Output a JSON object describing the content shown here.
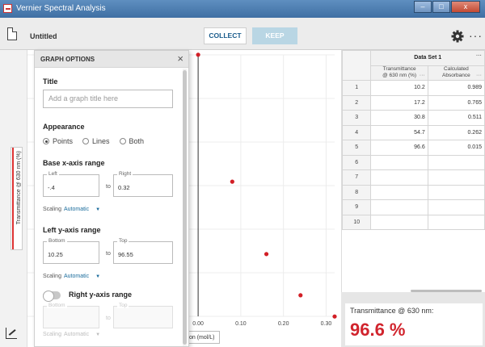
{
  "window": {
    "title": "Vernier Spectral Analysis",
    "minimize": "–",
    "maximize": "□",
    "close": "x"
  },
  "toolbar": {
    "doc_title": "Untitled",
    "collect_label": "COLLECT",
    "keep_label": "KEEP",
    "more": "···"
  },
  "graph_options": {
    "header": "GRAPH OPTIONS",
    "close": "×",
    "title_section": "Title",
    "title_placeholder": "Add a graph title here",
    "appearance_section": "Appearance",
    "appearance_options": [
      "Points",
      "Lines",
      "Both"
    ],
    "appearance_selected": "Points",
    "base_x": {
      "section": "Base x-axis range",
      "left_label": "Left",
      "left_value": "-.4",
      "right_label": "Right",
      "right_value": "0.32",
      "to": "to",
      "scaling_label": "Scaling",
      "scaling_value": "Automatic"
    },
    "left_y": {
      "section": "Left y-axis range",
      "bottom_label": "Bottom",
      "bottom_value": "10.25",
      "top_label": "Top",
      "top_value": "96.55",
      "to": "to",
      "scaling_label": "Scaling",
      "scaling_value": "Automatic"
    },
    "right_y": {
      "section": "Right y-axis range",
      "enabled": false,
      "bottom_label": "Bottom",
      "top_label": "Top",
      "to": "to",
      "scaling_label": "Scaling",
      "scaling_value": "Automatic"
    }
  },
  "graph": {
    "y_axis_label": "Transmittance @ 630 nm (%)",
    "x_axis_chip": "on (mol/L)"
  },
  "chart_data": {
    "type": "scatter",
    "x_ticks": [
      "0.00",
      "0.10",
      "0.20",
      "0.30"
    ],
    "xlim": [
      -0.4,
      0.32
    ],
    "ylim": [
      10.25,
      96.55
    ],
    "series": [
      {
        "values": [
          {
            "x": 0.08,
            "y": 54.7
          },
          {
            "x": 0.16,
            "y": 30.8
          },
          {
            "x": 0.24,
            "y": 17.2
          },
          {
            "x": 0.32,
            "y": 10.2
          },
          {
            "x": 0.0,
            "y": 96.6
          }
        ]
      }
    ],
    "point_color": "#d21f26"
  },
  "table": {
    "dataset": "Data Set 1",
    "col1_header_line1": "Transmittance",
    "col1_header_line2": "@ 630 nm (%)",
    "col2_header_line1": "Calculated",
    "col2_header_line2": "Absorbance",
    "more": "···",
    "row_numbers": [
      "1",
      "2",
      "3",
      "4",
      "5",
      "6",
      "7",
      "8",
      "9",
      "10"
    ],
    "col1": [
      "10.2",
      "17.2",
      "30.8",
      "54.7",
      "96.6",
      "",
      "",
      "",
      "",
      ""
    ],
    "col2": [
      "0.989",
      "0.765",
      "0.511",
      "0.262",
      "0.015",
      "",
      "",
      "",
      "",
      ""
    ]
  },
  "meter": {
    "label": "Transmittance @ 630 nm:",
    "value": "96.6 %"
  }
}
